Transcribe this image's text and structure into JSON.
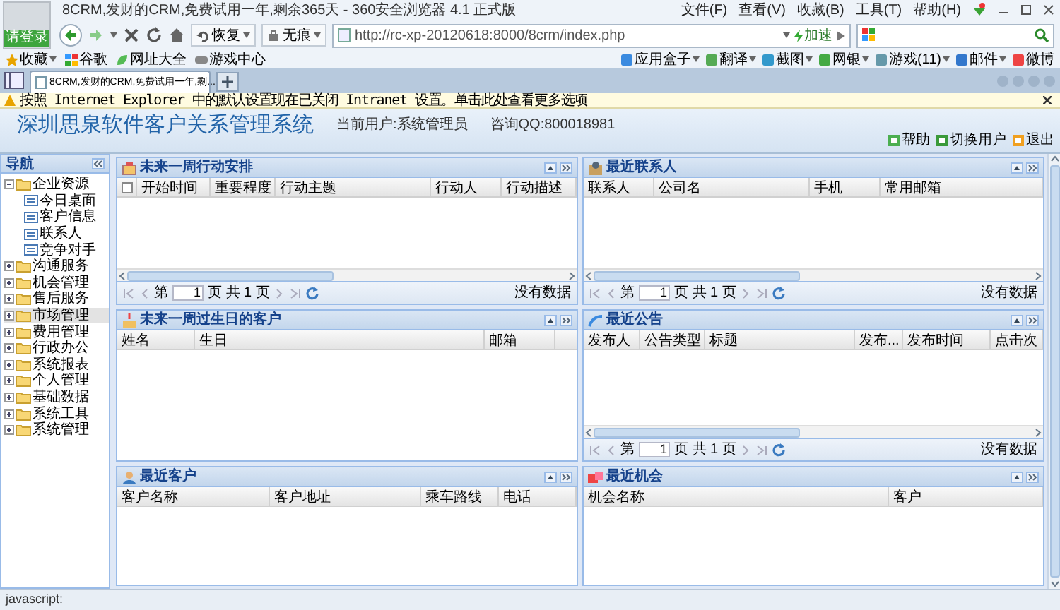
{
  "browser": {
    "title": "8CRM,发财的CRM,免费试用一年,剩余365天 - 360安全浏览器 4.1 正式版",
    "login_button": "请登录",
    "menu": [
      "文件(F)",
      "查看(V)",
      "收藏(B)",
      "工具(T)",
      "帮助(H)"
    ],
    "restore": "恢复",
    "incognito": "无痕",
    "address": "http://rc-xp-20120618:8000/8crm/index.php",
    "accelerate": "加速",
    "bookmarks": [
      "收藏",
      "谷歌",
      "网址大全",
      "游戏中心"
    ],
    "extensions": [
      "应用盒子",
      "翻译",
      "截图",
      "网银",
      "游戏(11)",
      "邮件",
      "微博"
    ],
    "tab": {
      "title": "8CRM,发财的CRM,免费试用一年,剩...",
      "selected": true
    },
    "infobar": "按照 Internet Explorer 中的默认设置现在已关闭 Intranet 设置。单击此处查看更多选项"
  },
  "app": {
    "title": "深圳思泉软件客户关系管理系统",
    "current_user": "当前用户:系统管理员",
    "support": "咨询QQ:800018981",
    "actions": [
      "帮助",
      "切换用户",
      "退出"
    ]
  },
  "nav": {
    "title": "导航",
    "items": [
      {
        "label": "企业资源",
        "expanded": true,
        "selected": false,
        "children": [
          {
            "label": "今日桌面",
            "selected": false
          },
          {
            "label": "客户信息",
            "selected": false
          },
          {
            "label": "联系人",
            "selected": false
          },
          {
            "label": "竞争对手",
            "selected": false
          }
        ]
      },
      {
        "label": "沟通服务",
        "expanded": false,
        "selected": false
      },
      {
        "label": "机会管理",
        "expanded": false,
        "selected": false
      },
      {
        "label": "售后服务",
        "expanded": false,
        "selected": false
      },
      {
        "label": "市场管理",
        "expanded": false,
        "selected": true
      },
      {
        "label": "费用管理",
        "expanded": false,
        "selected": false
      },
      {
        "label": "行政办公",
        "expanded": false,
        "selected": false
      },
      {
        "label": "系统报表",
        "expanded": false,
        "selected": false
      },
      {
        "label": "个人管理",
        "expanded": false,
        "selected": false
      },
      {
        "label": "基础数据",
        "expanded": false,
        "selected": false
      },
      {
        "label": "系统工具",
        "expanded": false,
        "selected": false
      },
      {
        "label": "系统管理",
        "expanded": false,
        "selected": false
      }
    ]
  },
  "panels": [
    {
      "title": "未来一周行动安排",
      "select_all": {
        "checked": false
      },
      "columns": [
        "开始时间",
        "重要程度",
        "行动主题",
        "行动人",
        "行动描述"
      ],
      "pager": {
        "page_label": "第",
        "page": "1",
        "total": "页 共 1 页",
        "status": "没有数据"
      }
    },
    {
      "title": "最近联系人",
      "columns": [
        "联系人",
        "公司名",
        "手机",
        "常用邮箱"
      ],
      "pager": {
        "page_label": "第",
        "page": "1",
        "total": "页 共 1 页",
        "status": "没有数据"
      }
    },
    {
      "title": "未来一周过生日的客户",
      "columns": [
        "姓名",
        "生日",
        "邮箱"
      ]
    },
    {
      "title": "最近公告",
      "columns": [
        "发布人",
        "公告类型",
        "标题",
        "发布...",
        "发布时间",
        "点击次"
      ],
      "pager": {
        "page_label": "第",
        "page": "1",
        "total": "页 共 1 页",
        "status": "没有数据"
      }
    },
    {
      "title": "最近客户",
      "columns": [
        "客户名称",
        "客户地址",
        "乘车路线",
        "电话"
      ]
    },
    {
      "title": "最近机会",
      "columns": [
        "机会名称",
        "客户"
      ]
    }
  ],
  "status_bar": "javascript:"
}
